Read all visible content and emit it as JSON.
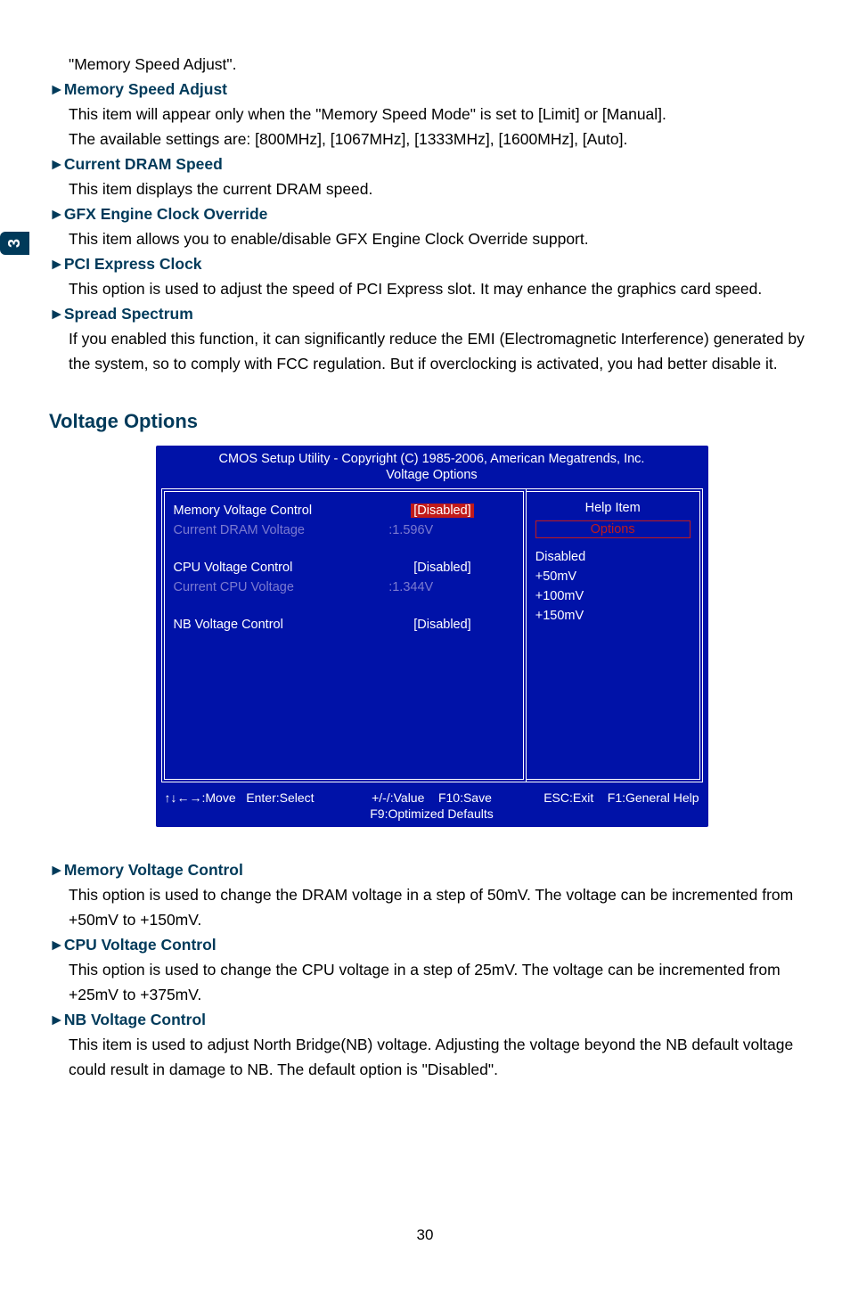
{
  "page_tab": "3",
  "intro_line": "\"Memory Speed Adjust\".",
  "sections": {
    "memory_speed_adjust": {
      "heading": "Memory Speed Adjust",
      "line1": "This item will appear only when the \"Memory Speed Mode\" is set to [Limit] or [Manual].",
      "line2": "The available settings are: [800MHz], [1067MHz], [1333MHz], [1600MHz], [Auto]."
    },
    "current_dram_speed": {
      "heading": "Current DRAM Speed",
      "line1": "This item displays the current DRAM speed."
    },
    "gfx_engine": {
      "heading": "GFX Engine Clock Override",
      "line1": "This item allows you to enable/disable GFX Engine Clock Override support."
    },
    "pci_express": {
      "heading": "PCI Express Clock",
      "line1": "This option is used to adjust the speed of PCI Express slot. It may enhance the graphics card speed."
    },
    "spread_spectrum": {
      "heading": "Spread Spectrum",
      "line1": "If you enabled this function, it can significantly reduce the EMI (Electromagnetic Interference) generated by the system, so to comply with FCC regulation. But if overclocking is activated, you had better disable it."
    }
  },
  "voltage_heading": "Voltage Options",
  "bios": {
    "header1": "CMOS Setup Utility - Copyright (C) 1985-2006, American Megatrends, Inc.",
    "header2": "Voltage Options",
    "rows": {
      "mem_voltage_ctrl_label": "Memory Voltage Control",
      "mem_voltage_ctrl_value": "[Disabled]",
      "cur_dram_v_label": "Current DRAM Voltage",
      "cur_dram_v_value": ":1.596V",
      "cpu_voltage_ctrl_label": "CPU Voltage Control",
      "cpu_voltage_ctrl_value": "[Disabled]",
      "cur_cpu_v_label": "Current CPU Voltage",
      "cur_cpu_v_value": ":1.344V",
      "nb_voltage_ctrl_label": "NB Voltage Control",
      "nb_voltage_ctrl_value": "[Disabled]"
    },
    "help_title": "Help Item",
    "options_title": "Options",
    "options_list": {
      "o1": "Disabled",
      "o2": "+50mV",
      "o3": "+100mV",
      "o4": "+150mV"
    },
    "footer": {
      "move": "↑↓←→:Move",
      "select": "Enter:Select",
      "value": "+/-/:Value",
      "save": "F10:Save",
      "exit": "ESC:Exit",
      "help": "F1:General Help",
      "defaults": "F9:Optimized Defaults"
    }
  },
  "lower_sections": {
    "memory_voltage_control": {
      "heading": "Memory Voltage Control",
      "line1": "This option is used to change the DRAM voltage in a step of 50mV. The voltage can be incremented from +50mV to +150mV."
    },
    "cpu_voltage_control": {
      "heading": "CPU Voltage Control",
      "line1": "This option is used to change the CPU voltage in a step of 25mV. The voltage can be incremented from +25mV to +375mV."
    },
    "nb_voltage_control": {
      "heading": "NB Voltage Control",
      "line1": "This item is used to adjust North Bridge(NB) voltage.  Adjusting the voltage beyond the NB default voltage could result in damage to NB. The default option is \"Disabled\"."
    }
  },
  "page_number": "30"
}
